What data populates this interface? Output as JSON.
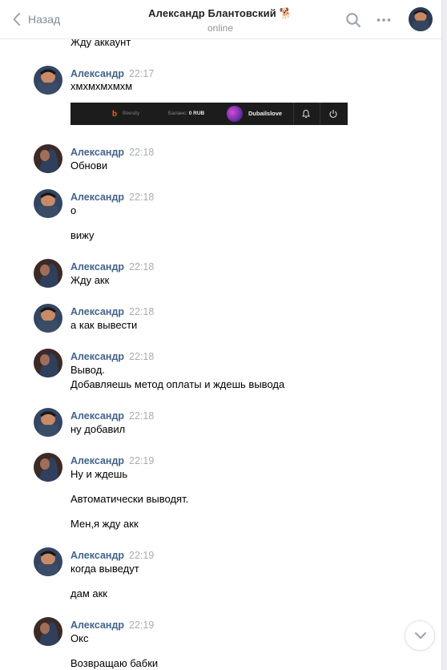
{
  "header": {
    "back_label": "Назад",
    "title": "Александр Блантовский",
    "title_emoji": "🐕",
    "status": "online"
  },
  "icons": {
    "back": "chevron-left-icon",
    "search": "search-icon",
    "more": "more-dots-icon",
    "scroll_down": "chevron-down-icon"
  },
  "colors": {
    "author": "#42648b",
    "time": "#a8adb3",
    "muted": "#818c99"
  },
  "messages": {
    "prev_tail": "Жду аккаунт",
    "groups": [
      {
        "author": "Александр",
        "time": "22:17",
        "lines": [
          "хмхмхмхмхм"
        ]
      },
      {
        "author": "Александр",
        "time": "22:18",
        "lines": [
          "Обнови"
        ]
      },
      {
        "author": "Александр",
        "time": "22:18",
        "lines": [
          "о",
          "вижу"
        ]
      },
      {
        "author": "Александр",
        "time": "22:18",
        "lines": [
          "Жду акк"
        ]
      },
      {
        "author": "Александр",
        "time": "22:18",
        "lines": [
          "а как вывести"
        ]
      },
      {
        "author": "Александр",
        "time": "22:18",
        "lines": [
          "Вывод.",
          "Добавляешь метод оплаты и ждешь вывода"
        ]
      },
      {
        "author": "Александр",
        "time": "22:18",
        "lines": [
          "ну добавил"
        ]
      },
      {
        "author": "Александр",
        "time": "22:19",
        "lines": [
          "Ну и ждешь",
          "Автоматически выводят.",
          "Мен,я жду акк"
        ]
      },
      {
        "author": "Александр",
        "time": "22:19",
        "lines": [
          "когда выведут",
          "дам акк"
        ]
      },
      {
        "author": "Александр",
        "time": "22:19",
        "lines": [
          "Окс",
          "Возвращаю бабки"
        ]
      }
    ]
  },
  "embed": {
    "logo_letter": "b",
    "logo_name": "Beesity",
    "balance_label": "Баланс:",
    "balance_value": "0 RUB",
    "username": "Dubailslove"
  }
}
